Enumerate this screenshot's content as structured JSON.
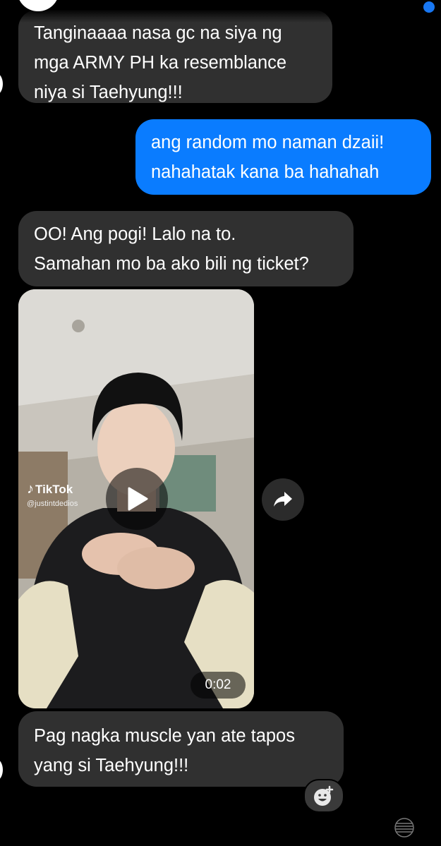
{
  "messages": [
    {
      "lines": [
        "Tanginaaaa nasa gc na siya ng",
        "mga ARMY PH ka resemblance",
        "niya si Taehyung!!!"
      ]
    },
    {
      "lines": [
        "ang random mo naman dzaii!",
        "nahahatak kana ba hahahah"
      ]
    },
    {
      "lines": [
        "OO! Ang pogi! Lalo na to.",
        "Samahan mo ba ako bili ng ticket?"
      ]
    },
    {
      "lines": [
        "Pag nagka muscle yan ate tapos",
        "yang si Taehyung!!!"
      ]
    }
  ],
  "video": {
    "brand": "TikTok",
    "handle": "@justintdedios",
    "duration": "0:02"
  },
  "colors": {
    "incoming_bubble": "#303030",
    "outgoing_bubble": "#0a7cff",
    "background": "#000000"
  },
  "icons": [
    "play-icon",
    "share-arrow-icon",
    "add-reaction-icon",
    "tiktok-logo-icon"
  ]
}
